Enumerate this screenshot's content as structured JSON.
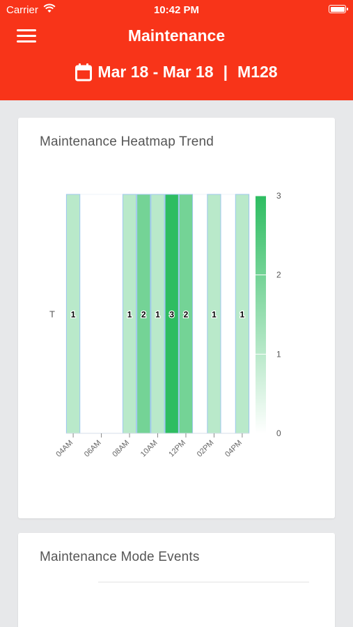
{
  "status_bar": {
    "carrier": "Carrier",
    "time": "10:42 PM"
  },
  "header": {
    "title": "Maintenance",
    "menu_icon": "hamburger-menu-icon"
  },
  "subheader": {
    "date_range": "Mar 18 - Mar 18",
    "separator": "|",
    "machine": "M128",
    "icon": "calendar-icon"
  },
  "heatmap_card": {
    "title": "Maintenance Heatmap Trend"
  },
  "events_card": {
    "title": "Maintenance Mode Events"
  },
  "colors": {
    "header_bg": "#f83419",
    "heat_max": "#2ebd61",
    "heat_min": "#ffffff",
    "cell_border": "#9fc7ee"
  },
  "chart_data": {
    "type": "heatmap",
    "title": "Maintenance Heatmap Trend",
    "y_categories": [
      "T"
    ],
    "x_tick_labels": [
      "04AM",
      "06AM",
      "08AM",
      "10AM",
      "12PM",
      "02PM",
      "04PM"
    ],
    "cells": [
      {
        "hour": "04AM",
        "value": 1
      },
      {
        "hour": "05AM",
        "value": 0
      },
      {
        "hour": "06AM",
        "value": 0
      },
      {
        "hour": "07AM",
        "value": 0
      },
      {
        "hour": "08AM",
        "value": 1
      },
      {
        "hour": "09AM",
        "value": 2
      },
      {
        "hour": "10AM",
        "value": 1
      },
      {
        "hour": "11AM",
        "value": 3
      },
      {
        "hour": "12PM",
        "value": 2
      },
      {
        "hour": "01PM",
        "value": 0
      },
      {
        "hour": "02PM",
        "value": 1
      },
      {
        "hour": "03PM",
        "value": 0
      },
      {
        "hour": "04PM",
        "value": 1
      }
    ],
    "color_scale": {
      "min": 0,
      "max": 3,
      "ticks": [
        0,
        1,
        2,
        3
      ]
    },
    "legend_placement": "right"
  }
}
